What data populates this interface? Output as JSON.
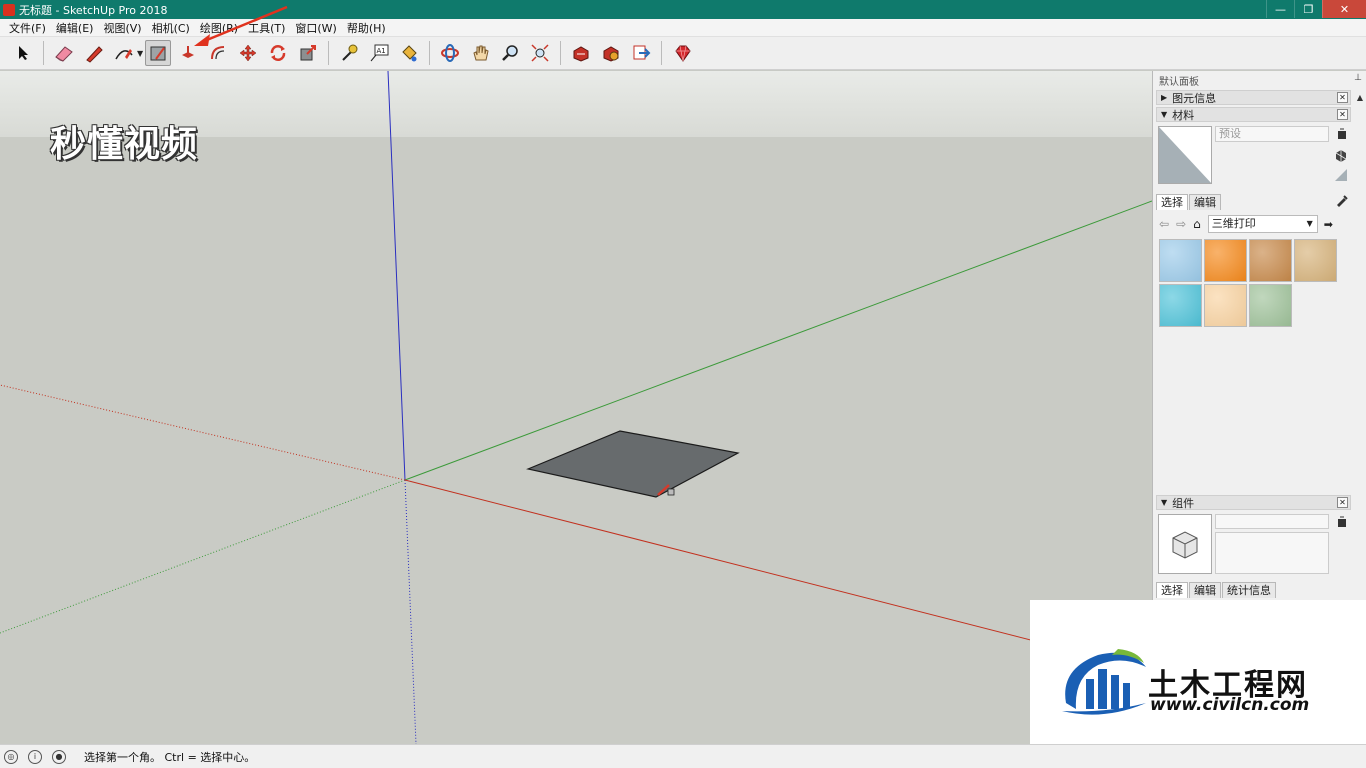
{
  "window": {
    "title": "无标题 - SketchUp Pro 2018",
    "minimize": "—",
    "restore": "❐",
    "close": "✕"
  },
  "menu": [
    {
      "label": "文件(F)"
    },
    {
      "label": "编辑(E)"
    },
    {
      "label": "视图(V)"
    },
    {
      "label": "相机(C)"
    },
    {
      "label": "绘图(R)"
    },
    {
      "label": "工具(T)"
    },
    {
      "label": "窗口(W)"
    },
    {
      "label": "帮助(H)"
    }
  ],
  "toolbar": {
    "tools": [
      {
        "name": "select-icon"
      },
      {
        "name": "eraser-icon"
      },
      {
        "name": "pencil-line-icon"
      },
      {
        "name": "arc-icon"
      },
      {
        "name": "rectangle-icon",
        "active": true
      },
      {
        "name": "push-pull-icon"
      },
      {
        "name": "offset-icon"
      },
      {
        "name": "move-icon"
      },
      {
        "name": "rotate-icon"
      },
      {
        "name": "scale-icon"
      },
      {
        "name": "tape-measure-icon"
      },
      {
        "name": "text-icon"
      },
      {
        "name": "paint-bucket-icon"
      },
      {
        "name": "orbit-icon"
      },
      {
        "name": "pan-icon"
      },
      {
        "name": "zoom-icon"
      },
      {
        "name": "zoom-extents-icon"
      },
      {
        "name": "warehouse-icon"
      },
      {
        "name": "extension-icon"
      },
      {
        "name": "send-to-layout-icon"
      },
      {
        "name": "ruby-icon"
      }
    ]
  },
  "watermark": {
    "text": "秒懂视频"
  },
  "panel": {
    "title": "默认面板",
    "entity_info": {
      "label": "图元信息"
    },
    "materials": {
      "label": "材料",
      "name_placeholder": "预设",
      "tabs": [
        {
          "label": "选择"
        },
        {
          "label": "编辑"
        }
      ],
      "library": "三维打印",
      "swatch_colors": [
        "#9ccbea",
        "#f5891b",
        "#c7894a",
        "#d6b27a",
        "#4fc3d9",
        "#f9d3a1",
        "#9fc29a"
      ]
    },
    "components": {
      "label": "组件",
      "tabs": [
        {
          "label": "选择"
        },
        {
          "label": "编辑"
        },
        {
          "label": "统计信息"
        }
      ]
    }
  },
  "logo": {
    "name": "土木工程网",
    "url": "www.civilcn.com"
  },
  "status": {
    "text": "选择第一个角。 Ctrl = 选择中心。"
  },
  "colors": {
    "titlebar": "#0f7a6c",
    "axis_red": "#c2311f",
    "axis_green": "#3c9a3a",
    "axis_blue": "#2a2fc0",
    "face": "#676b6d"
  }
}
